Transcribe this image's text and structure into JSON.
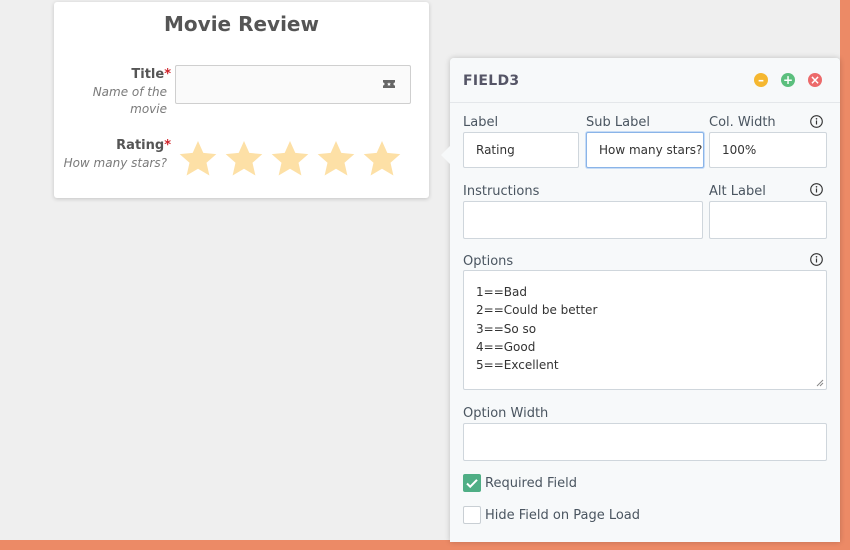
{
  "form": {
    "title": "Movie Review",
    "fields": {
      "title": {
        "label": "Title",
        "required_mark": "*",
        "sublabel": "Name of the movie",
        "icon": "ticket-icon"
      },
      "rating": {
        "label": "Rating",
        "required_mark": "*",
        "sublabel": "How many stars?",
        "stars": 5,
        "icon": "star-icon"
      }
    }
  },
  "panel": {
    "title": "FIELD3",
    "controls": {
      "minimize": "–",
      "maximize": "+",
      "close": "×"
    },
    "label": {
      "label": "Label",
      "value": "Rating"
    },
    "sub_label": {
      "label": "Sub Label",
      "value": "How many stars?"
    },
    "col_width": {
      "label": "Col. Width",
      "value": "100%"
    },
    "instructions": {
      "label": "Instructions",
      "value": ""
    },
    "alt_label": {
      "label": "Alt Label",
      "value": ""
    },
    "options": {
      "label": "Options",
      "lines": [
        "1==Bad",
        "2==Could be better",
        "3==So so",
        "4==Good",
        "5==Excellent"
      ]
    },
    "option_width": {
      "label": "Option Width",
      "value": ""
    },
    "required_field": {
      "label": "Required Field",
      "checked": true
    },
    "hide_field": {
      "label": "Hide Field on Page Load",
      "checked": false
    }
  },
  "colors": {
    "accent": "#ec8a66",
    "star": "#fde0a6",
    "minimize": "#f5b730",
    "maximize": "#5bbf7d",
    "close": "#ec6a6a",
    "check": "#4fae85"
  }
}
